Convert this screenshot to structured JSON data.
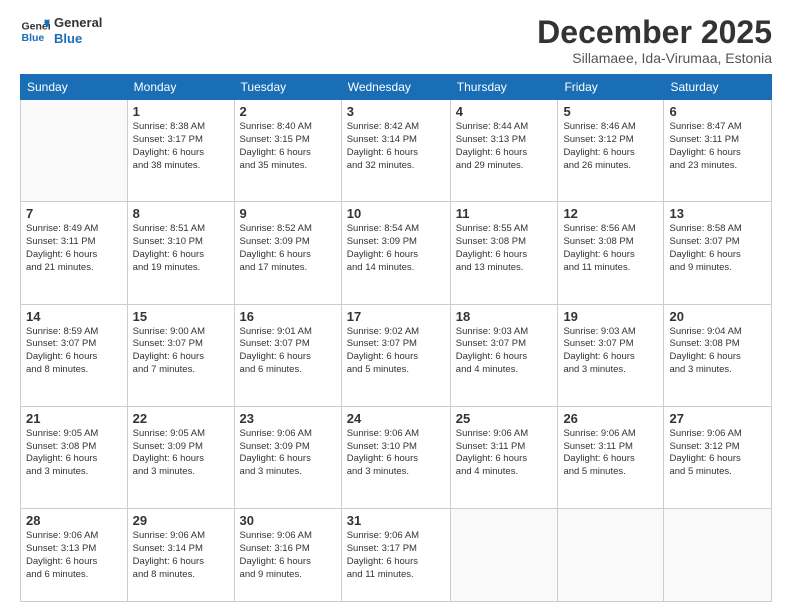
{
  "logo": {
    "line1": "General",
    "line2": "Blue"
  },
  "header": {
    "month": "December 2025",
    "location": "Sillamaee, Ida-Virumaa, Estonia"
  },
  "weekdays": [
    "Sunday",
    "Monday",
    "Tuesday",
    "Wednesday",
    "Thursday",
    "Friday",
    "Saturday"
  ],
  "weeks": [
    [
      {
        "day": "",
        "info": ""
      },
      {
        "day": "1",
        "info": "Sunrise: 8:38 AM\nSunset: 3:17 PM\nDaylight: 6 hours\nand 38 minutes."
      },
      {
        "day": "2",
        "info": "Sunrise: 8:40 AM\nSunset: 3:15 PM\nDaylight: 6 hours\nand 35 minutes."
      },
      {
        "day": "3",
        "info": "Sunrise: 8:42 AM\nSunset: 3:14 PM\nDaylight: 6 hours\nand 32 minutes."
      },
      {
        "day": "4",
        "info": "Sunrise: 8:44 AM\nSunset: 3:13 PM\nDaylight: 6 hours\nand 29 minutes."
      },
      {
        "day": "5",
        "info": "Sunrise: 8:46 AM\nSunset: 3:12 PM\nDaylight: 6 hours\nand 26 minutes."
      },
      {
        "day": "6",
        "info": "Sunrise: 8:47 AM\nSunset: 3:11 PM\nDaylight: 6 hours\nand 23 minutes."
      }
    ],
    [
      {
        "day": "7",
        "info": "Sunrise: 8:49 AM\nSunset: 3:11 PM\nDaylight: 6 hours\nand 21 minutes."
      },
      {
        "day": "8",
        "info": "Sunrise: 8:51 AM\nSunset: 3:10 PM\nDaylight: 6 hours\nand 19 minutes."
      },
      {
        "day": "9",
        "info": "Sunrise: 8:52 AM\nSunset: 3:09 PM\nDaylight: 6 hours\nand 17 minutes."
      },
      {
        "day": "10",
        "info": "Sunrise: 8:54 AM\nSunset: 3:09 PM\nDaylight: 6 hours\nand 14 minutes."
      },
      {
        "day": "11",
        "info": "Sunrise: 8:55 AM\nSunset: 3:08 PM\nDaylight: 6 hours\nand 13 minutes."
      },
      {
        "day": "12",
        "info": "Sunrise: 8:56 AM\nSunset: 3:08 PM\nDaylight: 6 hours\nand 11 minutes."
      },
      {
        "day": "13",
        "info": "Sunrise: 8:58 AM\nSunset: 3:07 PM\nDaylight: 6 hours\nand 9 minutes."
      }
    ],
    [
      {
        "day": "14",
        "info": "Sunrise: 8:59 AM\nSunset: 3:07 PM\nDaylight: 6 hours\nand 8 minutes."
      },
      {
        "day": "15",
        "info": "Sunrise: 9:00 AM\nSunset: 3:07 PM\nDaylight: 6 hours\nand 7 minutes."
      },
      {
        "day": "16",
        "info": "Sunrise: 9:01 AM\nSunset: 3:07 PM\nDaylight: 6 hours\nand 6 minutes."
      },
      {
        "day": "17",
        "info": "Sunrise: 9:02 AM\nSunset: 3:07 PM\nDaylight: 6 hours\nand 5 minutes."
      },
      {
        "day": "18",
        "info": "Sunrise: 9:03 AM\nSunset: 3:07 PM\nDaylight: 6 hours\nand 4 minutes."
      },
      {
        "day": "19",
        "info": "Sunrise: 9:03 AM\nSunset: 3:07 PM\nDaylight: 6 hours\nand 3 minutes."
      },
      {
        "day": "20",
        "info": "Sunrise: 9:04 AM\nSunset: 3:08 PM\nDaylight: 6 hours\nand 3 minutes."
      }
    ],
    [
      {
        "day": "21",
        "info": "Sunrise: 9:05 AM\nSunset: 3:08 PM\nDaylight: 6 hours\nand 3 minutes."
      },
      {
        "day": "22",
        "info": "Sunrise: 9:05 AM\nSunset: 3:09 PM\nDaylight: 6 hours\nand 3 minutes."
      },
      {
        "day": "23",
        "info": "Sunrise: 9:06 AM\nSunset: 3:09 PM\nDaylight: 6 hours\nand 3 minutes."
      },
      {
        "day": "24",
        "info": "Sunrise: 9:06 AM\nSunset: 3:10 PM\nDaylight: 6 hours\nand 3 minutes."
      },
      {
        "day": "25",
        "info": "Sunrise: 9:06 AM\nSunset: 3:11 PM\nDaylight: 6 hours\nand 4 minutes."
      },
      {
        "day": "26",
        "info": "Sunrise: 9:06 AM\nSunset: 3:11 PM\nDaylight: 6 hours\nand 5 minutes."
      },
      {
        "day": "27",
        "info": "Sunrise: 9:06 AM\nSunset: 3:12 PM\nDaylight: 6 hours\nand 5 minutes."
      }
    ],
    [
      {
        "day": "28",
        "info": "Sunrise: 9:06 AM\nSunset: 3:13 PM\nDaylight: 6 hours\nand 6 minutes."
      },
      {
        "day": "29",
        "info": "Sunrise: 9:06 AM\nSunset: 3:14 PM\nDaylight: 6 hours\nand 8 minutes."
      },
      {
        "day": "30",
        "info": "Sunrise: 9:06 AM\nSunset: 3:16 PM\nDaylight: 6 hours\nand 9 minutes."
      },
      {
        "day": "31",
        "info": "Sunrise: 9:06 AM\nSunset: 3:17 PM\nDaylight: 6 hours\nand 11 minutes."
      },
      {
        "day": "",
        "info": ""
      },
      {
        "day": "",
        "info": ""
      },
      {
        "day": "",
        "info": ""
      }
    ]
  ]
}
